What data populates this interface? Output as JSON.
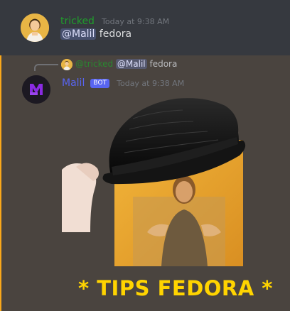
{
  "messages": [
    {
      "author": "tricked",
      "timestamp": "Today at 9:38 AM",
      "mention": "@Malil",
      "text": "fedora",
      "author_color": "#1f9e2b"
    },
    {
      "reply": {
        "author": "@tricked",
        "mention": "@Malil",
        "text": "fedora"
      },
      "author": "Malil",
      "badge": "BOT",
      "timestamp": "Today at 9:38 AM",
      "author_color": "#5865f2",
      "attachment": {
        "caption": "* TIPS FEDORA *",
        "caption_color": "#ffd400"
      }
    }
  ],
  "colors": {
    "background": "#36393f",
    "highlight": "#4a443f",
    "highlight_border": "#faa81a",
    "mention_bg": "rgba(114,137,218,0.3)"
  },
  "icons": {
    "avatar_tricked": "person-avatar-icon",
    "avatar_malil": "malil-logo-icon"
  }
}
